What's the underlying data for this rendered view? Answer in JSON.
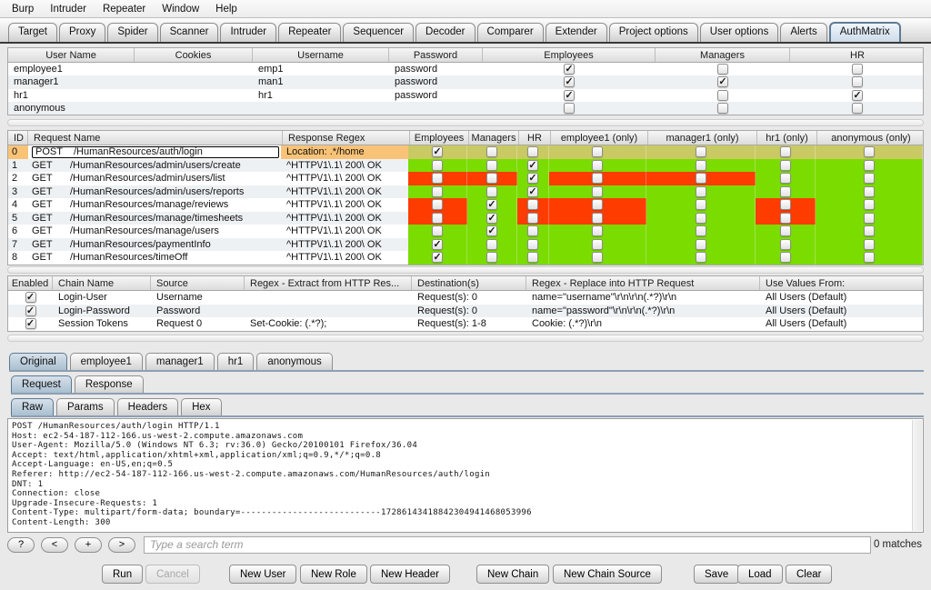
{
  "menu_bar": {
    "items": [
      "Burp",
      "Intruder",
      "Repeater",
      "Window",
      "Help"
    ]
  },
  "main_tabs": {
    "selected": "AuthMatrix",
    "items": [
      "Target",
      "Proxy",
      "Spider",
      "Scanner",
      "Intruder",
      "Repeater",
      "Sequencer",
      "Decoder",
      "Comparer",
      "Extender",
      "Project options",
      "User options",
      "Alerts",
      "AuthMatrix"
    ]
  },
  "users_table": {
    "columns": [
      "User Name",
      "Cookies",
      "Username",
      "Password",
      "Employees",
      "Managers",
      "HR"
    ],
    "rows": [
      {
        "user": "employee1",
        "cookies": "",
        "username": "emp1",
        "password": "password",
        "checks": [
          true,
          false,
          false
        ]
      },
      {
        "user": "manager1",
        "cookies": "",
        "username": "man1",
        "password": "password",
        "checks": [
          true,
          true,
          false
        ]
      },
      {
        "user": "hr1",
        "cookies": "",
        "username": "hr1",
        "password": "password",
        "checks": [
          true,
          false,
          true
        ]
      },
      {
        "user": "anonymous",
        "cookies": "",
        "username": "",
        "password": "",
        "checks": [
          false,
          false,
          false
        ]
      }
    ]
  },
  "requests_table": {
    "columns": [
      "ID",
      "Request Name",
      "Response Regex",
      "Employees",
      "Managers",
      "HR",
      "employee1 (only)",
      "manager1 (only)",
      "hr1 (only)",
      "anonymous (only)"
    ],
    "rows": [
      {
        "id": "0",
        "method": "POST",
        "path": "/HumanResources/auth/login",
        "regex": "Location: .*/home",
        "selected": true,
        "checks": [
          true,
          false,
          false,
          false,
          false,
          false,
          false
        ],
        "cell_colors": [
          "sel",
          "sel",
          "sel",
          "sel",
          "sel",
          "sel",
          "sel"
        ]
      },
      {
        "id": "1",
        "method": "GET",
        "path": "/HumanResources/admin/users/create",
        "regex": "^HTTP\\/1\\.1\\ 200\\ OK",
        "selected": false,
        "checks": [
          false,
          false,
          true,
          false,
          false,
          false,
          false
        ],
        "cell_colors": [
          "pass",
          "pass",
          "pass",
          "pass",
          "pass",
          "pass",
          "pass"
        ]
      },
      {
        "id": "2",
        "method": "GET",
        "path": "/HumanResources/admin/users/list",
        "regex": "^HTTP\\/1\\.1\\ 200\\ OK",
        "selected": false,
        "checks": [
          false,
          false,
          true,
          false,
          false,
          false,
          false
        ],
        "cell_colors": [
          "fail",
          "fail",
          "pass",
          "fail",
          "fail",
          "pass",
          "pass"
        ]
      },
      {
        "id": "3",
        "method": "GET",
        "path": "/HumanResources/admin/users/reports",
        "regex": "^HTTP\\/1\\.1\\ 200\\ OK",
        "selected": false,
        "checks": [
          false,
          false,
          true,
          false,
          false,
          false,
          false
        ],
        "cell_colors": [
          "pass",
          "pass",
          "pass",
          "pass",
          "pass",
          "pass",
          "pass"
        ]
      },
      {
        "id": "4",
        "method": "GET",
        "path": "/HumanResources/manage/reviews",
        "regex": "^HTTP\\/1\\.1\\ 200\\ OK",
        "selected": false,
        "checks": [
          false,
          true,
          false,
          false,
          false,
          false,
          false
        ],
        "cell_colors": [
          "fail",
          "pass",
          "fail",
          "fail",
          "pass",
          "fail",
          "pass"
        ]
      },
      {
        "id": "5",
        "method": "GET",
        "path": "/HumanResources/manage/timesheets",
        "regex": "^HTTP\\/1\\.1\\ 200\\ OK",
        "selected": false,
        "checks": [
          false,
          true,
          false,
          false,
          false,
          false,
          false
        ],
        "cell_colors": [
          "fail",
          "pass",
          "fail",
          "fail",
          "pass",
          "fail",
          "pass"
        ]
      },
      {
        "id": "6",
        "method": "GET",
        "path": "/HumanResources/manage/users",
        "regex": "^HTTP\\/1\\.1\\ 200\\ OK",
        "selected": false,
        "checks": [
          false,
          true,
          false,
          false,
          false,
          false,
          false
        ],
        "cell_colors": [
          "pass",
          "pass",
          "pass",
          "pass",
          "pass",
          "pass",
          "pass"
        ]
      },
      {
        "id": "7",
        "method": "GET",
        "path": "/HumanResources/paymentInfo",
        "regex": "^HTTP\\/1\\.1\\ 200\\ OK",
        "selected": false,
        "checks": [
          true,
          false,
          false,
          false,
          false,
          false,
          false
        ],
        "cell_colors": [
          "pass",
          "pass",
          "pass",
          "pass",
          "pass",
          "pass",
          "pass"
        ]
      },
      {
        "id": "8",
        "method": "GET",
        "path": "/HumanResources/timeOff",
        "regex": "^HTTP\\/1\\.1\\ 200\\ OK",
        "selected": false,
        "checks": [
          true,
          false,
          false,
          false,
          false,
          false,
          false
        ],
        "cell_colors": [
          "pass",
          "pass",
          "pass",
          "pass",
          "pass",
          "pass",
          "pass"
        ]
      }
    ]
  },
  "chains_table": {
    "columns": [
      "Enabled",
      "Chain Name",
      "Source",
      "Regex - Extract from HTTP Res...",
      "Destination(s)",
      "Regex - Replace into HTTP Request",
      "Use Values From:"
    ],
    "rows": [
      {
        "enabled": true,
        "name": "Login-User",
        "source": "Username",
        "extract": "",
        "dest": "Request(s): 0",
        "replace": "name=\"username\"\\r\\n\\r\\n(.*?)\\r\\n",
        "use_values": "All Users (Default)"
      },
      {
        "enabled": true,
        "name": "Login-Password",
        "source": "Password",
        "extract": "",
        "dest": "Request(s): 0",
        "replace": "name=\"password\"\\r\\n\\r\\n(.*?)\\r\\n",
        "use_values": "All Users (Default)"
      },
      {
        "enabled": true,
        "name": "Session Tokens",
        "source": "Request 0",
        "extract": "Set-Cookie: (.*?);",
        "dest": "Request(s): 1-8",
        "replace": "Cookie: (.*?)\\r\\n",
        "use_values": "All Users (Default)"
      }
    ]
  },
  "user_tabs": {
    "selected": "Original",
    "items": [
      "Original",
      "employee1",
      "manager1",
      "hr1",
      "anonymous"
    ]
  },
  "message_tabs": {
    "selected": "Request",
    "items": [
      "Request",
      "Response"
    ]
  },
  "format_tabs": {
    "selected": "Raw",
    "items": [
      "Raw",
      "Params",
      "Headers",
      "Hex"
    ]
  },
  "request_text": [
    "POST /HumanResources/auth/login HTTP/1.1",
    "Host: ec2-54-187-112-166.us-west-2.compute.amazonaws.com",
    "User-Agent: Mozilla/5.0 (Windows NT 6.3; rv:36.0) Gecko/20100101 Firefox/36.04",
    "Accept: text/html,application/xhtml+xml,application/xml;q=0.9,*/*;q=0.8",
    "Accept-Language: en-US,en;q=0.5",
    "Referer: http://ec2-54-187-112-166.us-west-2.compute.amazonaws.com/HumanResources/auth/login",
    "DNT: 1",
    "Connection: close",
    "Upgrade-Insecure-Requests: 1",
    "Content-Type: multipart/form-data; boundary=---------------------------17286143418842304941468053996",
    "Content-Length: 300"
  ],
  "search_bar": {
    "help": "?",
    "prev": "<",
    "add": "+",
    "next": ">",
    "placeholder": "Type a search term",
    "matches": "0 matches"
  },
  "action_buttons": [
    {
      "label": "Run",
      "disabled": false
    },
    {
      "label": "Cancel",
      "disabled": true
    },
    {
      "label": "New User",
      "disabled": false
    },
    {
      "label": "New Role",
      "disabled": false
    },
    {
      "label": "New Header",
      "disabled": false
    },
    {
      "label": "New Chain",
      "disabled": false
    },
    {
      "label": "New Chain Source",
      "disabled": false
    },
    {
      "label": "Save",
      "disabled": false
    },
    {
      "label": "Load",
      "disabled": false
    },
    {
      "label": "Clear",
      "disabled": false
    }
  ],
  "colors": {
    "pass": "#7bdc00",
    "fail": "#ff3c00",
    "selected_row": "#c9ca63",
    "selected_cell": "#f9c377"
  }
}
